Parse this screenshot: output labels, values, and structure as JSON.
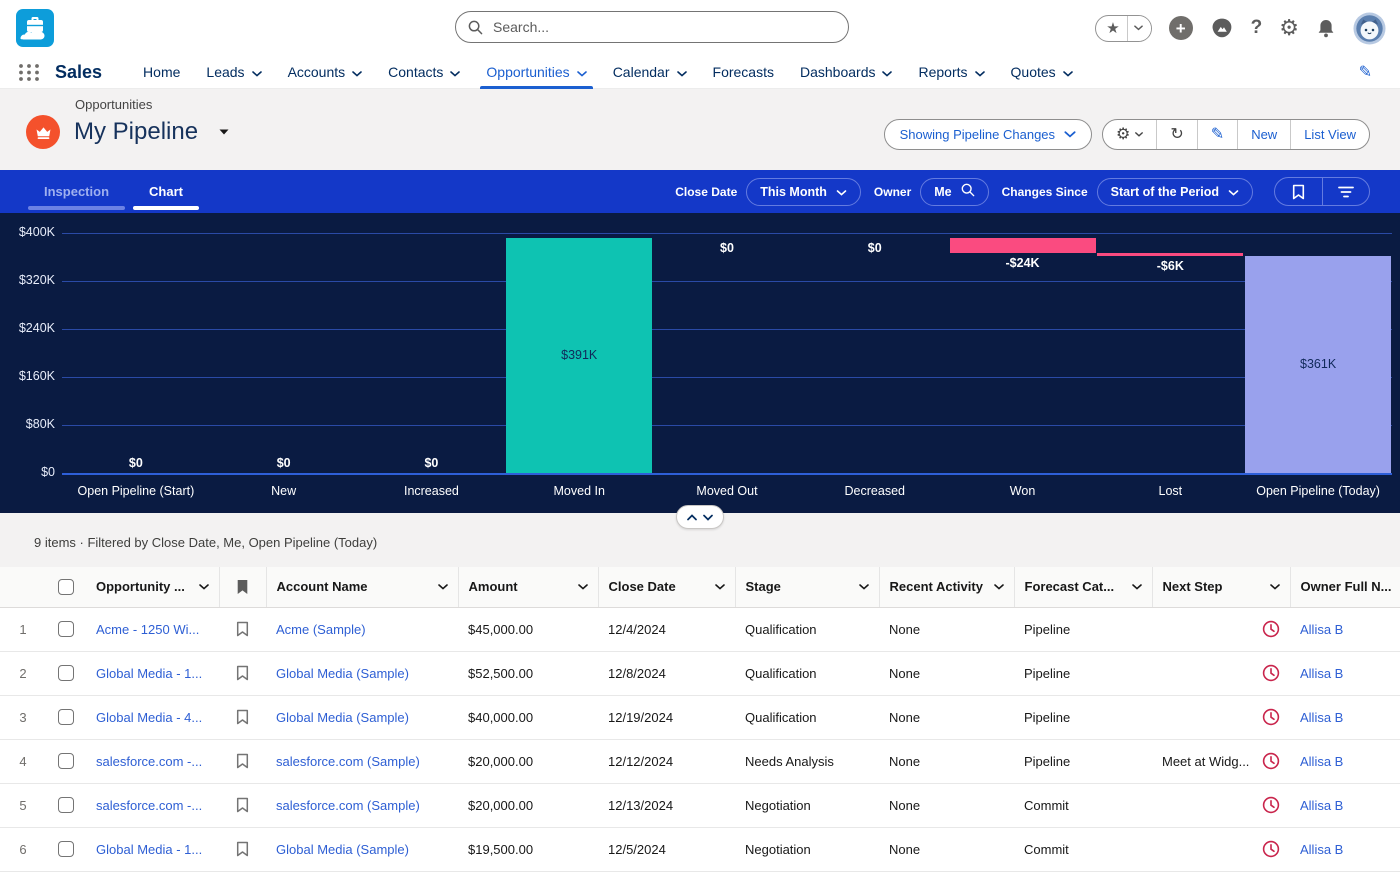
{
  "colors": {
    "toolbar_blue": "#1438c8",
    "chart_background": "#0a1b42",
    "teal_bar": "#0ec3b2",
    "pink_bar": "#fa4b80",
    "purple_bar": "#99a1ed",
    "link_blue": "#2e5fd4",
    "clock_red": "#c9254c",
    "opportunity_orange": "#f4512c",
    "logo_blue": "#0d9dda",
    "active_tab_blue": "#1b5fd0"
  },
  "app_header": {
    "search": {
      "placeholder": "Search...",
      "icon": "search-icon"
    },
    "action_icons": [
      "favorites-star-icon",
      "add-circle-icon",
      "trailhead-icon",
      "help-icon",
      "setup-gear-icon",
      "notifications-bell-icon",
      "user-avatar"
    ]
  },
  "nav": {
    "app_name": "Sales",
    "tabs": [
      {
        "label": "Home",
        "has_menu": false,
        "active": false
      },
      {
        "label": "Leads",
        "has_menu": true,
        "active": false
      },
      {
        "label": "Accounts",
        "has_menu": true,
        "active": false
      },
      {
        "label": "Contacts",
        "has_menu": true,
        "active": false
      },
      {
        "label": "Opportunities",
        "has_menu": true,
        "active": true
      },
      {
        "label": "Calendar",
        "has_menu": true,
        "active": false
      },
      {
        "label": "Forecasts",
        "has_menu": false,
        "active": false
      },
      {
        "label": "Dashboards",
        "has_menu": true,
        "active": false
      },
      {
        "label": "Reports",
        "has_menu": true,
        "active": false
      },
      {
        "label": "Quotes",
        "has_menu": true,
        "active": false
      }
    ]
  },
  "page_header": {
    "object_label": "Opportunities",
    "title": "My Pipeline",
    "view_selector": "Showing Pipeline Changes",
    "action_buttons": {
      "new": "New",
      "list_view": "List View"
    }
  },
  "toolbar": {
    "tabs": [
      {
        "label": "Inspection",
        "active": false
      },
      {
        "label": "Chart",
        "active": true
      }
    ],
    "filters": [
      {
        "label": "Close Date",
        "value": "This Month",
        "control": "dropdown"
      },
      {
        "label": "Owner",
        "value": "Me",
        "control": "search"
      },
      {
        "label": "Changes Since",
        "value": "Start of the Period",
        "control": "dropdown"
      }
    ]
  },
  "chart_data": {
    "type": "bar",
    "subtype": "waterfall",
    "title": "",
    "categories": [
      "Open Pipeline (Start)",
      "New",
      "Increased",
      "Moved In",
      "Moved Out",
      "Decreased",
      "Won",
      "Lost",
      "Open Pipeline (Today)"
    ],
    "values": [
      0,
      0,
      0,
      391000,
      0,
      0,
      -24000,
      -6000,
      361000
    ],
    "segments": [
      {
        "category": "Open Pipeline (Start)",
        "display": "$0",
        "from": 0,
        "to": 0,
        "color": null,
        "label_pos": "baseline"
      },
      {
        "category": "New",
        "display": "$0",
        "from": 0,
        "to": 0,
        "color": null,
        "label_pos": "baseline"
      },
      {
        "category": "Increased",
        "display": "$0",
        "from": 0,
        "to": 0,
        "color": null,
        "label_pos": "baseline"
      },
      {
        "category": "Moved In",
        "display": "$391K",
        "from": 0,
        "to": 391000,
        "color": "teal",
        "label_pos": "inside"
      },
      {
        "category": "Moved Out",
        "display": "$0",
        "from": 391000,
        "to": 391000,
        "color": null,
        "label_pos": "below"
      },
      {
        "category": "Decreased",
        "display": "$0",
        "from": 391000,
        "to": 391000,
        "color": null,
        "label_pos": "below"
      },
      {
        "category": "Won",
        "display": "-$24K",
        "from": 391000,
        "to": 367000,
        "color": "pink",
        "label_pos": "below"
      },
      {
        "category": "Lost",
        "display": "-$6K",
        "from": 367000,
        "to": 361000,
        "color": "pink",
        "label_pos": "below"
      },
      {
        "category": "Open Pipeline (Today)",
        "display": "$361K",
        "from": 0,
        "to": 361000,
        "color": "purple",
        "label_pos": "inside"
      }
    ],
    "y_ticks": [
      {
        "label": "$400K",
        "value": 400000
      },
      {
        "label": "$320K",
        "value": 320000
      },
      {
        "label": "$240K",
        "value": 240000
      },
      {
        "label": "$160K",
        "value": 160000
      },
      {
        "label": "$80K",
        "value": 80000
      },
      {
        "label": "$0",
        "value": 0
      }
    ],
    "ylim": [
      0,
      400000
    ],
    "grid": true,
    "legend": null
  },
  "status_bar": {
    "summary": "9 items · Filtered by Close Date, Me, Open Pipeline (Today)"
  },
  "table": {
    "columns": [
      {
        "key": "num",
        "label": "",
        "has_menu": false
      },
      {
        "key": "checkbox",
        "label": "",
        "has_menu": false
      },
      {
        "key": "name",
        "label": "Opportunity ...",
        "has_menu": true
      },
      {
        "key": "flag",
        "label": "",
        "has_menu": false,
        "icon": "bookmark-icon"
      },
      {
        "key": "account",
        "label": "Account Name",
        "has_menu": true
      },
      {
        "key": "amount",
        "label": "Amount",
        "has_menu": true
      },
      {
        "key": "close_date",
        "label": "Close Date",
        "has_menu": true
      },
      {
        "key": "stage",
        "label": "Stage",
        "has_menu": true
      },
      {
        "key": "recent_activity",
        "label": "Recent Activity",
        "has_menu": true
      },
      {
        "key": "forecast_category",
        "label": "Forecast Cat...",
        "has_menu": true
      },
      {
        "key": "next_step",
        "label": "Next Step",
        "has_menu": true
      },
      {
        "key": "owner",
        "label": "Owner Full N...",
        "has_menu": false
      }
    ],
    "rows": [
      {
        "num": "1",
        "name": "Acme - 1250 Wi...",
        "account": "Acme (Sample)",
        "amount": "$45,000.00",
        "close_date": "12/4/2024",
        "stage": "Qualification",
        "recent_activity": "None",
        "forecast_category": "Pipeline",
        "next_step": "",
        "has_clock": true,
        "owner": "Allisa B"
      },
      {
        "num": "2",
        "name": "Global Media - 1...",
        "account": "Global Media (Sample)",
        "amount": "$52,500.00",
        "close_date": "12/8/2024",
        "stage": "Qualification",
        "recent_activity": "None",
        "forecast_category": "Pipeline",
        "next_step": "",
        "has_clock": true,
        "owner": "Allisa B"
      },
      {
        "num": "3",
        "name": "Global Media - 4...",
        "account": "Global Media (Sample)",
        "amount": "$40,000.00",
        "close_date": "12/19/2024",
        "stage": "Qualification",
        "recent_activity": "None",
        "forecast_category": "Pipeline",
        "next_step": "",
        "has_clock": true,
        "owner": "Allisa B"
      },
      {
        "num": "4",
        "name": "salesforce.com -...",
        "account": "salesforce.com (Sample)",
        "amount": "$20,000.00",
        "close_date": "12/12/2024",
        "stage": "Needs Analysis",
        "recent_activity": "None",
        "forecast_category": "Pipeline",
        "next_step": "Meet at Widg...",
        "has_clock": true,
        "owner": "Allisa B"
      },
      {
        "num": "5",
        "name": "salesforce.com -...",
        "account": "salesforce.com (Sample)",
        "amount": "$20,000.00",
        "close_date": "12/13/2024",
        "stage": "Negotiation",
        "recent_activity": "None",
        "forecast_category": "Commit",
        "next_step": "",
        "has_clock": true,
        "owner": "Allisa B"
      },
      {
        "num": "6",
        "name": "Global Media - 1...",
        "account": "Global Media (Sample)",
        "amount": "$19,500.00",
        "close_date": "12/5/2024",
        "stage": "Negotiation",
        "recent_activity": "None",
        "forecast_category": "Commit",
        "next_step": "",
        "has_clock": true,
        "owner": "Allisa B"
      }
    ]
  }
}
